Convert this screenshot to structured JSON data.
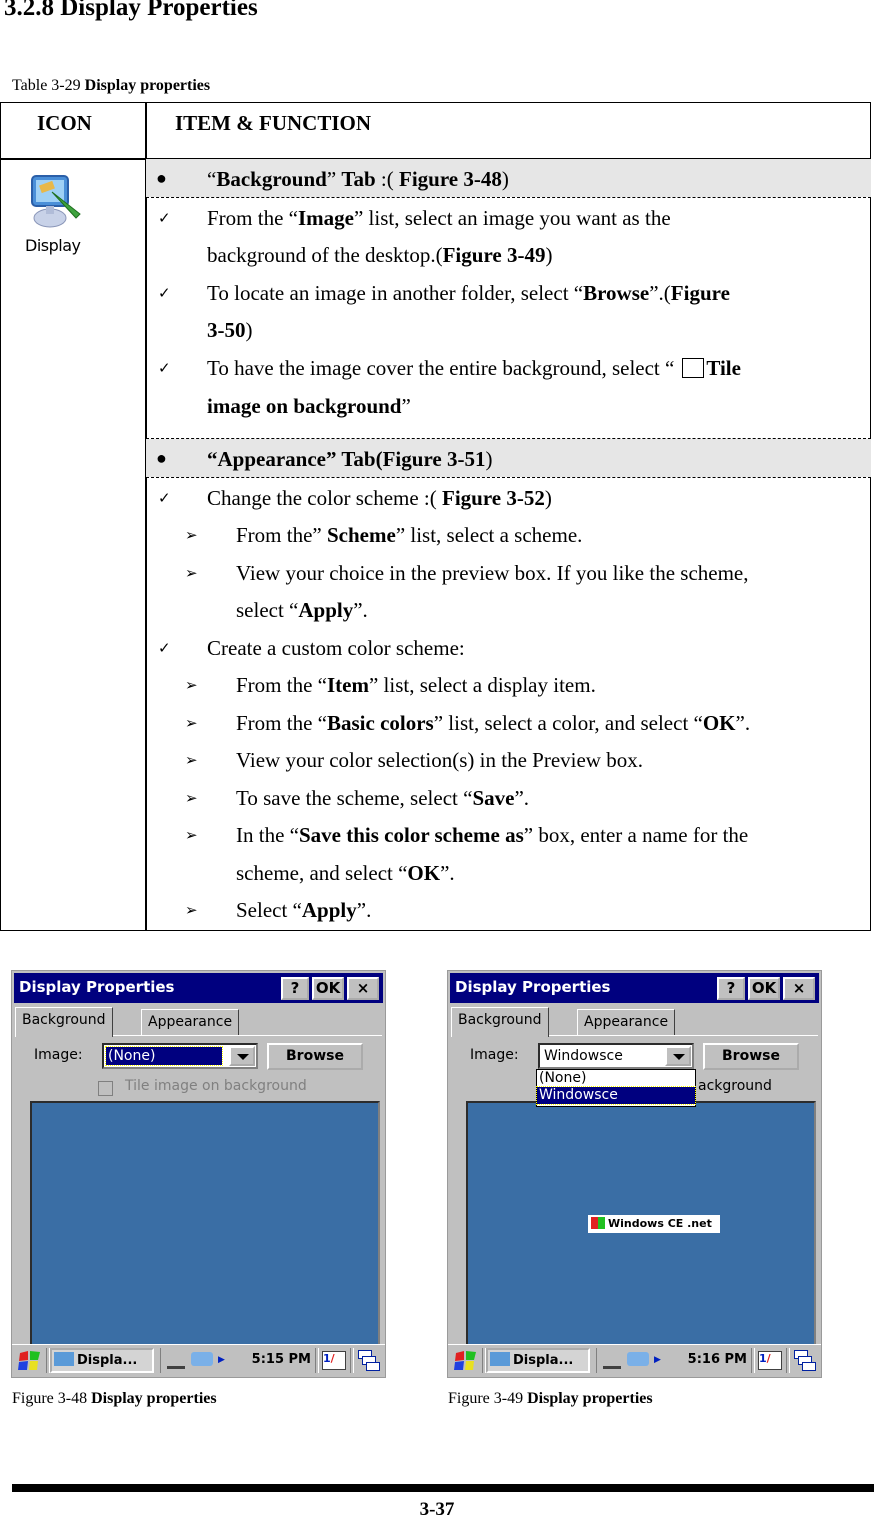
{
  "section_title": "3.2.8 Display Properties",
  "table_caption": {
    "prefix": "Table 3-29 ",
    "title": "Display properties"
  },
  "table": {
    "headers": {
      "icon": "ICON",
      "item": "ITEM & FUNCTION"
    },
    "icon_label": "Display",
    "background_tab": {
      "open_quote": "“",
      "name": "Background",
      "close_quote": "” ",
      "tab": "Tab",
      "mid": " :( ",
      "fig": "Figure 3-48",
      "end": ")"
    },
    "background_items": [
      {
        "pre": "From the “",
        "b": "Image",
        "post": "” list, select an image you want as the"
      },
      {
        "cont": "background of the desktop.(",
        "b": "Figure 3-49",
        "post": ")"
      },
      {
        "pre": "To locate an image in another folder, select “",
        "b": "Browse",
        "mid": "”.(",
        "b2": "Figure"
      },
      {
        "b": "3-50",
        "post": ")"
      },
      {
        "pre": "To have the image cover the entire background, select “",
        "b": "Tile"
      },
      {
        "b": "image on background",
        "post": "”"
      }
    ],
    "appearance_tab": {
      "b": "“Appearance” Tab(Figure 3-51",
      "end": ")"
    },
    "appearance_items": [
      {
        "type": "check",
        "pre": "Change the color scheme :( ",
        "b": "Figure 3-52",
        "post": ")"
      },
      {
        "type": "arrow",
        "pre": "From the” ",
        "b": "Scheme",
        "post": "” list, select a scheme."
      },
      {
        "type": "arrow",
        "pre": "View your choice in the preview box. If you like the scheme,"
      },
      {
        "type": "cont",
        "pre": "select “",
        "b": "Apply",
        "post": "”."
      },
      {
        "type": "check",
        "pre": "Create a custom color scheme:"
      },
      {
        "type": "arrow",
        "pre": "From the “",
        "b": "Item",
        "post": "” list, select a display item."
      },
      {
        "type": "arrow",
        "pre": "From the “",
        "b": "Basic colors",
        "post": "” list, select a color, and select “",
        "b2": "OK",
        "post2": "”."
      },
      {
        "type": "arrow",
        "pre": "View your color selection(s) in the Preview box."
      },
      {
        "type": "arrow",
        "pre": "To save the scheme, select “",
        "b": "Save",
        "post": "”."
      },
      {
        "type": "arrow",
        "pre": "In the “",
        "b": "Save this color scheme as",
        "post": "” box, enter a name for the"
      },
      {
        "type": "cont",
        "pre": "scheme, and select “",
        "b": "OK",
        "post": "”."
      },
      {
        "type": "arrow",
        "pre": "Select “",
        "b": "Apply",
        "post": "”."
      }
    ]
  },
  "figures": [
    {
      "window_title": "Display Properties",
      "help_btn": "?",
      "ok_btn": "OK",
      "close_btn": "×",
      "tabs": [
        "Background",
        "Appearance"
      ],
      "image_label": "Image:",
      "image_value": "(None)",
      "browse_label": "Browse",
      "tile_label": "Tile image on background",
      "task_item": "Displa...",
      "clock": "5:15 PM",
      "caption_prefix": "Figure 3-48 ",
      "caption_title": "Display properties",
      "preview_color": "#3a6ea5"
    },
    {
      "window_title": "Display Properties",
      "help_btn": "?",
      "ok_btn": "OK",
      "close_btn": "×",
      "tabs": [
        "Background",
        "Appearance"
      ],
      "image_label": "Image:",
      "image_value": "Windowsce",
      "dropdown_options": [
        "(None)",
        "Windowsce"
      ],
      "browse_label": "Browse",
      "tile_label_partial": "ackground",
      "logo_text": "Windows CE .net",
      "task_item": "Displa...",
      "clock": "5:16 PM",
      "caption_prefix": "Figure 3-49 ",
      "caption_title": "Display properties",
      "preview_color": "#3a6ea5"
    }
  ],
  "page_number": "3-37"
}
